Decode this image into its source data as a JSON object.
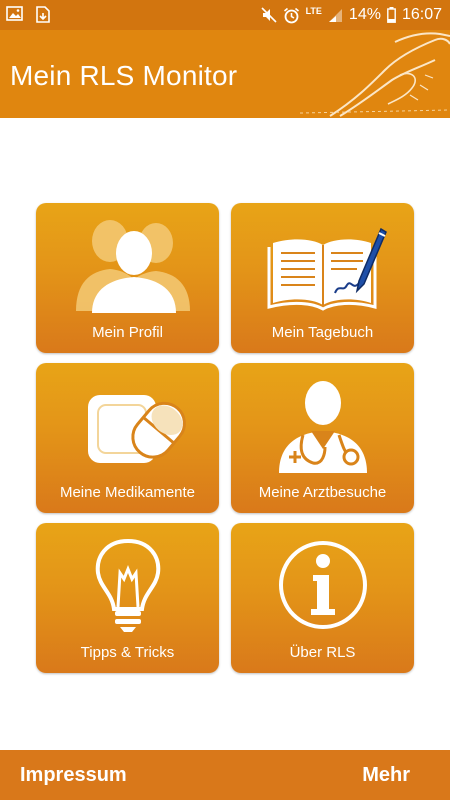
{
  "status_bar": {
    "battery": "14%",
    "time": "16:07",
    "network": "LTE",
    "icons": [
      "gallery-icon",
      "download-icon",
      "mute-icon",
      "alarm-icon",
      "signal-icon",
      "battery-icon"
    ]
  },
  "app_bar": {
    "title": "Mein RLS Monitor"
  },
  "tiles": [
    {
      "label": "Mein Profil",
      "icon": "profile-icon"
    },
    {
      "label": "Mein Tagebuch",
      "icon": "diary-icon"
    },
    {
      "label": "Meine Medikamente",
      "icon": "medication-icon"
    },
    {
      "label": "Meine Arztbesuche",
      "icon": "doctor-icon"
    },
    {
      "label": "Tipps & Tricks",
      "icon": "lightbulb-icon"
    },
    {
      "label": "Über RLS",
      "icon": "info-icon"
    }
  ],
  "bottom_bar": {
    "left_label": "Impressum",
    "right_label": "Mehr"
  },
  "colors": {
    "header": "#e0860f",
    "status_bar": "#d2750f",
    "tile_top": "#e8a417",
    "tile_bottom": "#d9791a",
    "bottom_bar": "#d9781a"
  }
}
